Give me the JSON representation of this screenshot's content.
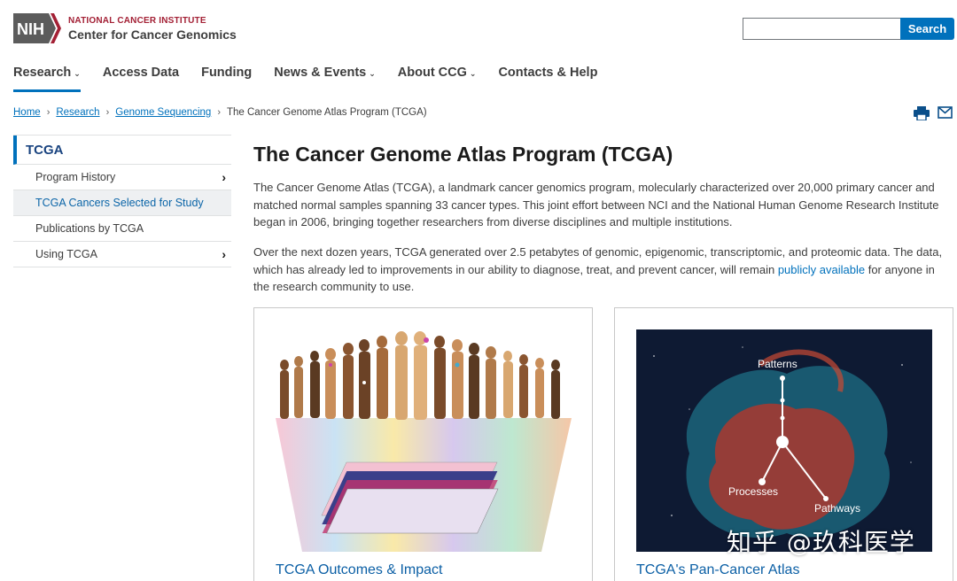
{
  "header": {
    "logo_text": "NIH",
    "org_line1": "NATIONAL CANCER INSTITUTE",
    "org_line2": "Center for Cancer Genomics",
    "search_value": "",
    "search_button": "Search"
  },
  "nav": {
    "items": [
      {
        "label": "Research",
        "caret": "⌄"
      },
      {
        "label": "Access Data",
        "caret": ""
      },
      {
        "label": "Funding",
        "caret": ""
      },
      {
        "label": "News & Events",
        "caret": "⌄"
      },
      {
        "label": "About CCG",
        "caret": "⌄"
      },
      {
        "label": "Contacts & Help",
        "caret": ""
      }
    ]
  },
  "breadcrumb": {
    "items": [
      "Home",
      "Research",
      "Genome Sequencing"
    ],
    "current": "The Cancer Genome Atlas Program (TCGA)",
    "separator": "›"
  },
  "icons": {
    "print": "print-icon",
    "email": "email-icon"
  },
  "sidebar": {
    "heading": "TCGA",
    "items": [
      {
        "label": "Program History",
        "chevron": "›"
      },
      {
        "label": "TCGA Cancers Selected for Study",
        "chevron": ""
      },
      {
        "label": "Publications by TCGA",
        "chevron": ""
      },
      {
        "label": "Using TCGA",
        "chevron": "›"
      }
    ]
  },
  "main": {
    "title": "The Cancer Genome Atlas Program (TCGA)",
    "paragraph1": "The Cancer Genome Atlas (TCGA), a landmark cancer genomics program, molecularly characterized over 20,000 primary cancer and matched normal samples spanning 33 cancer types. This joint effort between NCI and the National Human Genome Research Institute began in 2006, bringing together researchers from diverse disciplines and multiple institutions.",
    "paragraph2_before": "Over the next dozen years, TCGA generated over 2.5 petabytes of genomic, epigenomic, transcriptomic, and proteomic data. The data, which has already led to improvements in our ability to diagnose, treat, and prevent cancer, will remain ",
    "paragraph2_link": "publicly available",
    "paragraph2_after": " for anyone in the research community to use."
  },
  "cards": [
    {
      "title": "TCGA Outcomes & Impact"
    },
    {
      "title": "TCGA's Pan-Cancer Atlas",
      "labels": [
        "Patterns",
        "Processes",
        "Pathways"
      ]
    }
  ],
  "watermark": "知乎 @玖科医学",
  "colors": {
    "primary": "#0071bc",
    "nih_red": "#a32035",
    "heading_blue": "#1a4480"
  }
}
